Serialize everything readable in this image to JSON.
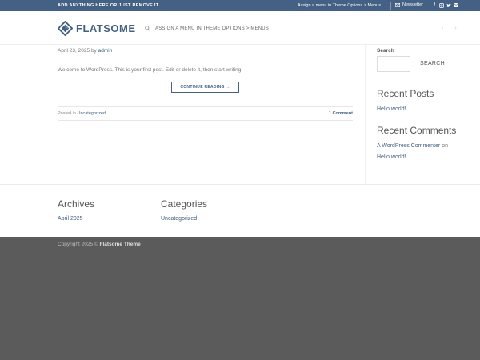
{
  "topbar": {
    "left_text": "ADD ANYTHING HERE OR JUST REMOVE IT...",
    "menu_link": "Assign a menu in Theme Options > Menus",
    "newsletter": "Newsletter",
    "social_icons": [
      "facebook-icon",
      "instagram-icon",
      "twitter-icon",
      "email-icon"
    ]
  },
  "header": {
    "logo_text": "FLATSOME",
    "nav_text": "ASSIGN A MENU IN THEME OPTIONS > MENUS",
    "arrows": [
      "‹",
      "›"
    ]
  },
  "post": {
    "date": "April 23, 2025",
    "by": "by",
    "author": "admin",
    "excerpt": "Welcome to WordPress. This is your first post. Edit or delete it, then start writing!",
    "button": "CONTINUE READING →",
    "posted_in": "Posted in",
    "category": "Uncategorized",
    "comments": "1 Comment"
  },
  "sidebar": {
    "search_label": "Search",
    "search_button": "SEARCH",
    "recent_posts_title": "Recent Posts",
    "recent_posts": [
      "Hello world!"
    ],
    "recent_comments_title": "Recent Comments",
    "comment_author": "A WordPress Commenter",
    "comment_on": "on",
    "comment_post": "Hello world!"
  },
  "footer": {
    "archives_title": "Archives",
    "archives": [
      "April 2025"
    ],
    "categories_title": "Categories",
    "categories": [
      "Uncategorized"
    ],
    "copyright_prefix": "Copyright 2025 ©",
    "copyright_brand": "Flatsome Theme"
  },
  "colors": {
    "primary": "#446084",
    "footer_bg": "#5b5b5b"
  }
}
